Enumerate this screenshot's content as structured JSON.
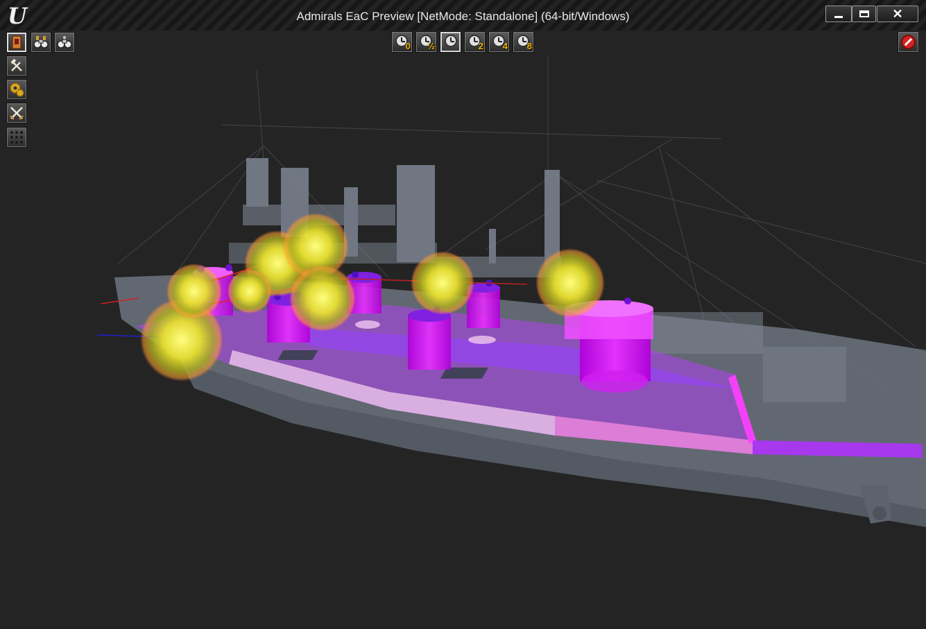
{
  "window": {
    "title": "Admirals EaC Preview [NetMode: Standalone]  (64-bit/Windows)",
    "logo": "U",
    "close_glyph": "✕"
  },
  "hud": {
    "left_toolbar": [
      {
        "icon": "ship-card-icon",
        "active": true
      },
      {
        "icon": "tools-icon",
        "active": false
      },
      {
        "icon": "gears-icon",
        "active": false
      },
      {
        "icon": "crossed-swords-icon",
        "active": false
      },
      {
        "icon": "grid-dots-icon",
        "active": false
      }
    ],
    "view_buttons": [
      {
        "icon": "binoculars-icon"
      },
      {
        "icon": "binoculars-gear-icon"
      }
    ],
    "speed_controls": [
      {
        "label": "0",
        "active": false
      },
      {
        "label": "½",
        "active": false
      },
      {
        "label": "",
        "active": true
      },
      {
        "label": "2",
        "active": false
      },
      {
        "label": "4",
        "active": false
      },
      {
        "label": "8",
        "active": false
      }
    ],
    "stop_icon": "stop-circle-icon"
  },
  "colors": {
    "background": "#242424",
    "hull": "#7d8592",
    "overlay_magenta": "#d316f0",
    "overlay_purple": "#8c3cf0",
    "explosion_yellow": "#f4e640",
    "speed_label": "#f2b400",
    "stop_red": "#d42222"
  }
}
